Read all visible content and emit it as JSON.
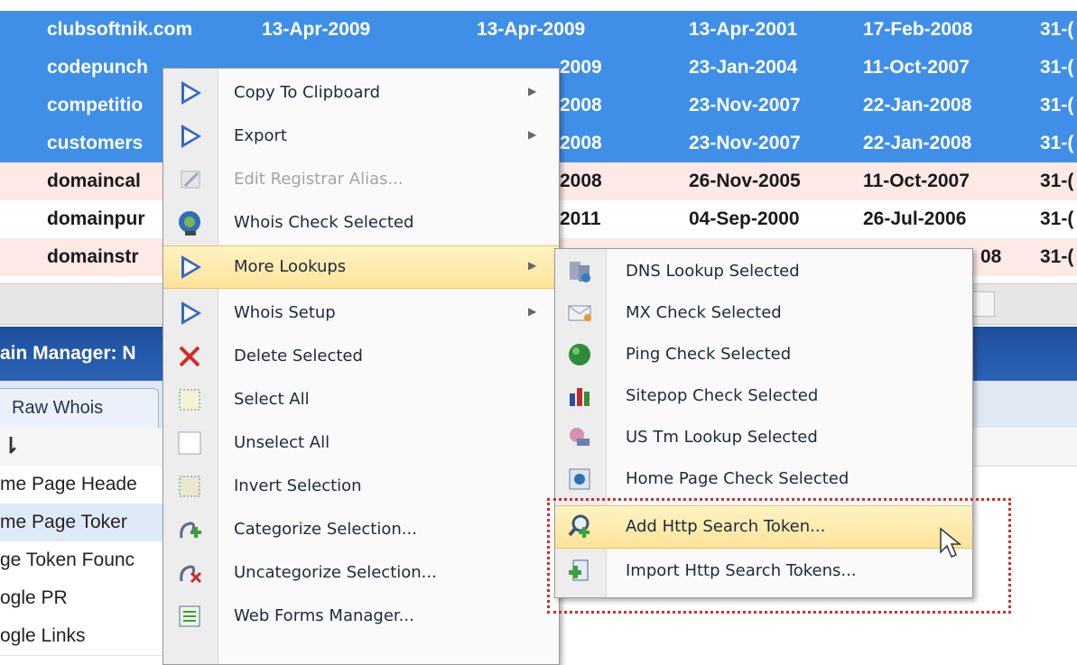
{
  "grid": {
    "rows": [
      {
        "style": "sel",
        "cells": [
          "clubsoftnik.com",
          "13-Apr-2009",
          "13-Apr-2009",
          "13-Apr-2001",
          "17-Feb-2008",
          "31-("
        ]
      },
      {
        "style": "sel",
        "cells": [
          "codepunch",
          "",
          "2009",
          "23-Jan-2004",
          "11-Oct-2007",
          "31-("
        ]
      },
      {
        "style": "sel",
        "cells": [
          "competitio",
          "",
          "2008",
          "23-Nov-2007",
          "22-Jan-2008",
          "31-("
        ]
      },
      {
        "style": "sel",
        "cells": [
          "customers",
          "",
          "2008",
          "23-Nov-2007",
          "22-Jan-2008",
          "31-("
        ]
      },
      {
        "style": "pink",
        "cells": [
          "domaincal",
          "",
          "2008",
          "26-Nov-2005",
          "11-Oct-2007",
          "31-("
        ]
      },
      {
        "style": "white",
        "cells": [
          "domainpur",
          "",
          "2011",
          "04-Sep-2000",
          "26-Jul-2006",
          "31-("
        ]
      },
      {
        "style": "pink",
        "cells": [
          "domainstr",
          "",
          "",
          "",
          "08",
          "31-("
        ]
      }
    ]
  },
  "panel": {
    "title": "ain Manager: N"
  },
  "tabs": {
    "raw_whois": "Raw Whois"
  },
  "properties": [
    "me Page Heade",
    "me Page Toker",
    "ge Token Founc",
    "ogle PR",
    "ogle Links"
  ],
  "context_menu": {
    "items": [
      {
        "label": "Copy To Clipboard",
        "icon": "play-arrow-icon",
        "submenu": true
      },
      {
        "label": "Export",
        "icon": "play-arrow-icon",
        "submenu": true
      },
      {
        "label": "Edit Registrar Alias...",
        "icon": "edit-pencil-icon",
        "disabled": true
      },
      {
        "label": "Whois Check Selected",
        "icon": "globe-search-icon"
      },
      {
        "label": "More Lookups",
        "icon": "play-arrow-icon",
        "submenu": true,
        "active": true
      },
      {
        "label": "Whois Setup",
        "icon": "play-arrow-icon",
        "submenu": true
      },
      {
        "label": "Delete Selected",
        "icon": "delete-x-icon"
      },
      {
        "label": "Select All",
        "icon": "select-all-icon"
      },
      {
        "label": "Unselect All",
        "icon": "unselect-all-icon"
      },
      {
        "label": "Invert Selection",
        "icon": "invert-selection-icon"
      },
      {
        "label": "Categorize Selection...",
        "icon": "categorize-icon"
      },
      {
        "label": "Uncategorize Selection...",
        "icon": "uncategorize-icon"
      },
      {
        "label": "Web Forms Manager...",
        "icon": "web-forms-icon"
      }
    ]
  },
  "submenu": {
    "items": [
      {
        "label": "DNS Lookup Selected",
        "icon": "dns-servers-icon"
      },
      {
        "label": "MX Check Selected",
        "icon": "mail-icon"
      },
      {
        "label": "Ping Check Selected",
        "icon": "green-globe-icon"
      },
      {
        "label": "Sitepop Check Selected",
        "icon": "bar-chart-icon"
      },
      {
        "label": "US Tm Lookup Selected",
        "icon": "trademark-icon"
      },
      {
        "label": "Home Page Check Selected",
        "icon": "home-page-icon"
      },
      {
        "label": "Add Http Search Token...",
        "icon": "magnifier-add-icon",
        "active": true
      },
      {
        "label": "Import Http Search Tokens...",
        "icon": "import-icon"
      }
    ]
  },
  "colors": {
    "selected_row": "#3f8fe8",
    "pink_row": "#fde9e6",
    "highlight": "#fde39a",
    "annotation": "#d52b2b"
  }
}
